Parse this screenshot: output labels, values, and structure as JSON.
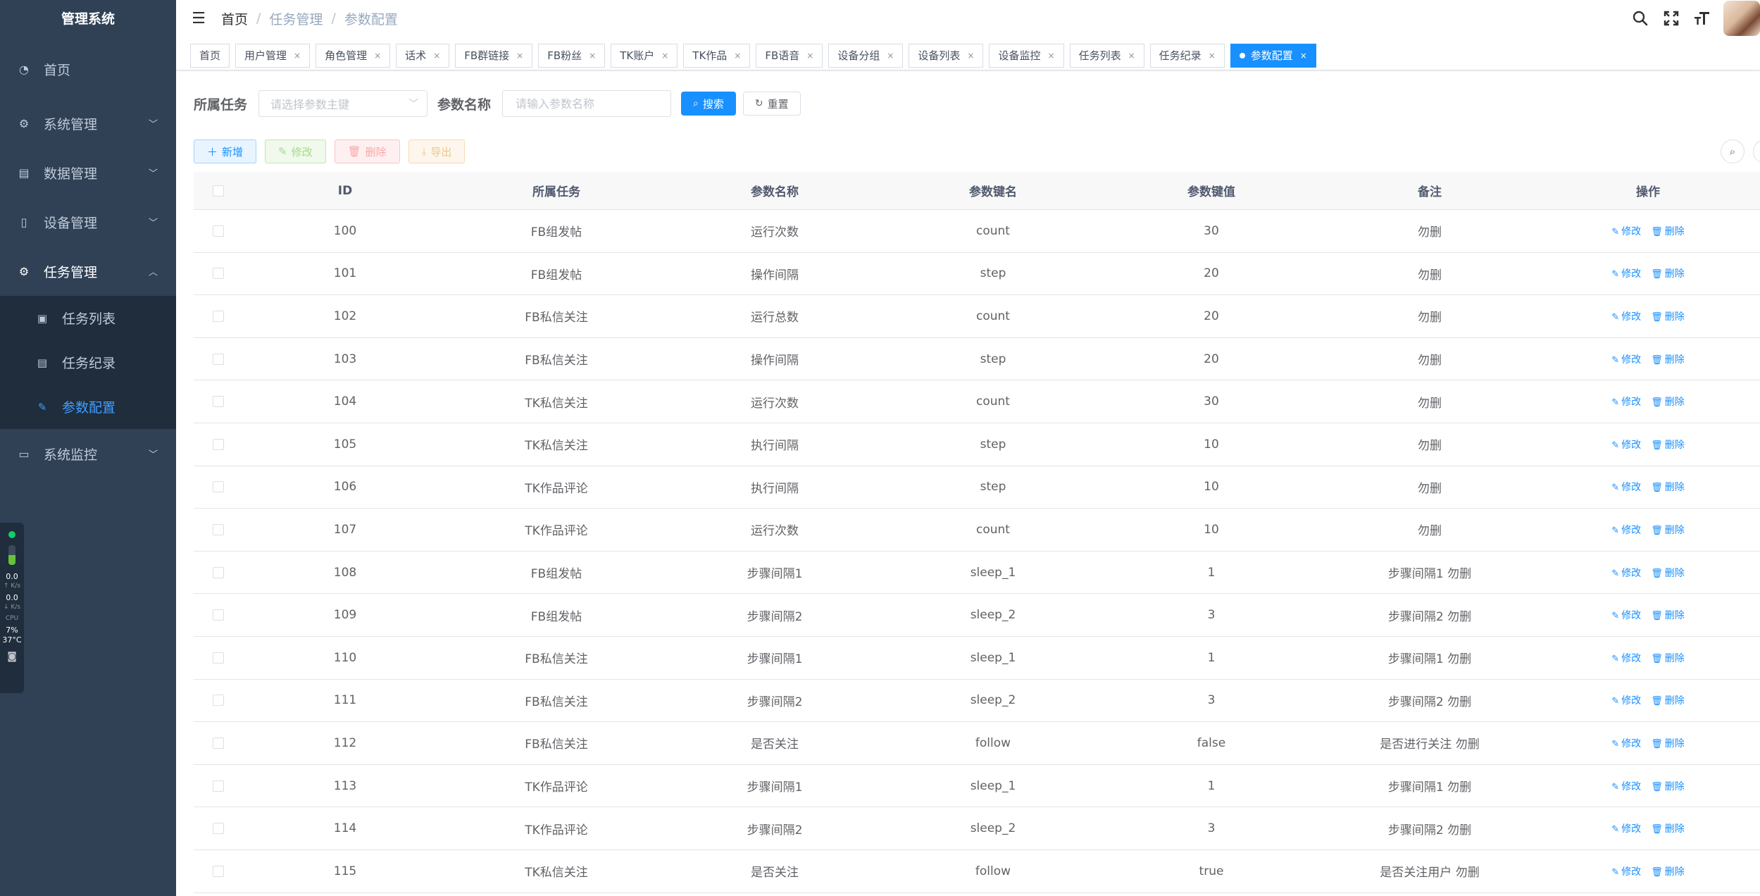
{
  "app_title": "管理系统",
  "sidebar": {
    "items": [
      {
        "label": "首页",
        "icon": "dashboard-icon",
        "glyph": "◔"
      },
      {
        "label": "系统管理",
        "icon": "system-icon",
        "glyph": "⚙",
        "chevron": "﹀"
      },
      {
        "label": "数据管理",
        "icon": "data-icon",
        "glyph": "▤",
        "chevron": "﹀"
      },
      {
        "label": "设备管理",
        "icon": "phone-icon",
        "glyph": "▯",
        "chevron": "﹀"
      },
      {
        "label": "任务管理",
        "icon": "task-icon",
        "glyph": "⚙",
        "chevron": "︿"
      }
    ],
    "submenu": [
      {
        "label": "任务列表",
        "icon": "task-list-icon",
        "glyph": "▣"
      },
      {
        "label": "任务纪录",
        "icon": "task-log-icon",
        "glyph": "▤"
      },
      {
        "label": "参数配置",
        "icon": "edit-icon",
        "glyph": "✎"
      }
    ],
    "monitor_item": {
      "label": "系统监控",
      "icon": "monitor-icon",
      "glyph": "▭",
      "chevron": "﹀"
    }
  },
  "monitor": {
    "up_value": "0.0",
    "up_unit": "↑ K/s",
    "down_value": "0.0",
    "down_unit": "↓ K/s",
    "cpu_label": "CPU",
    "cpu_value": "7%",
    "temp": "37°C",
    "memory_level": 0.5,
    "status_color": "#13ce66"
  },
  "breadcrumb": {
    "home": "首页",
    "parent": "任务管理",
    "current": "参数配置",
    "separator": "/"
  },
  "tags": [
    {
      "label": "首页",
      "closable": false
    },
    {
      "label": "用户管理",
      "closable": true
    },
    {
      "label": "角色管理",
      "closable": true
    },
    {
      "label": "话术",
      "closable": true
    },
    {
      "label": "FB群链接",
      "closable": true
    },
    {
      "label": "FB粉丝",
      "closable": true
    },
    {
      "label": "TK账户",
      "closable": true
    },
    {
      "label": "TK作品",
      "closable": true
    },
    {
      "label": "FB语音",
      "closable": true
    },
    {
      "label": "设备分组",
      "closable": true
    },
    {
      "label": "设备列表",
      "closable": true
    },
    {
      "label": "设备监控",
      "closable": true
    },
    {
      "label": "任务列表",
      "closable": true
    },
    {
      "label": "任务纪录",
      "closable": true
    },
    {
      "label": "参数配置",
      "closable": true,
      "active": true
    }
  ],
  "search": {
    "task_label": "所属任务",
    "task_placeholder": "请选择参数主键",
    "name_label": "参数名称",
    "name_placeholder": "请输入参数名称",
    "search_btn": "搜索",
    "reset_btn": "重置"
  },
  "toolbar": {
    "add": "新增",
    "edit": "修改",
    "delete": "删除",
    "export": "导出"
  },
  "table": {
    "headers": [
      "ID",
      "所属任务",
      "参数名称",
      "参数键名",
      "参数键值",
      "备注",
      "操作"
    ],
    "edit_label": "修改",
    "delete_label": "删除",
    "rows": [
      [
        "100",
        "FB组发帖",
        "运行次数",
        "count",
        "30",
        "勿删"
      ],
      [
        "101",
        "FB组发帖",
        "操作间隔",
        "step",
        "20",
        "勿删"
      ],
      [
        "102",
        "FB私信关注",
        "运行总数",
        "count",
        "20",
        "勿删"
      ],
      [
        "103",
        "FB私信关注",
        "操作间隔",
        "step",
        "20",
        "勿删"
      ],
      [
        "104",
        "TK私信关注",
        "运行次数",
        "count",
        "30",
        "勿删"
      ],
      [
        "105",
        "TK私信关注",
        "执行间隔",
        "step",
        "10",
        "勿删"
      ],
      [
        "106",
        "TK作品评论",
        "执行间隔",
        "step",
        "10",
        "勿删"
      ],
      [
        "107",
        "TK作品评论",
        "运行次数",
        "count",
        "10",
        "勿删"
      ],
      [
        "108",
        "FB组发帖",
        "步骤间隔1",
        "sleep_1",
        "1",
        "步骤间隔1 勿删"
      ],
      [
        "109",
        "FB组发帖",
        "步骤间隔2",
        "sleep_2",
        "3",
        "步骤间隔2 勿删"
      ],
      [
        "110",
        "FB私信关注",
        "步骤间隔1",
        "sleep_1",
        "1",
        "步骤间隔1 勿删"
      ],
      [
        "111",
        "FB私信关注",
        "步骤间隔2",
        "sleep_2",
        "3",
        "步骤间隔2 勿删"
      ],
      [
        "112",
        "FB私信关注",
        "是否关注",
        "follow",
        "false",
        "是否进行关注 勿删"
      ],
      [
        "113",
        "TK作品评论",
        "步骤间隔1",
        "sleep_1",
        "1",
        "步骤间隔1 勿删"
      ],
      [
        "114",
        "TK作品评论",
        "步骤间隔2",
        "sleep_2",
        "3",
        "步骤间隔2 勿删"
      ],
      [
        "115",
        "TK私信关注",
        "是否关注",
        "follow",
        "true",
        "是否关注用户 勿删"
      ]
    ]
  },
  "colors": {
    "sidebar_bg": "#304156",
    "submenu_bg": "#1f2d3d",
    "accent": "#1890ff",
    "menu_active": "#409eff"
  }
}
